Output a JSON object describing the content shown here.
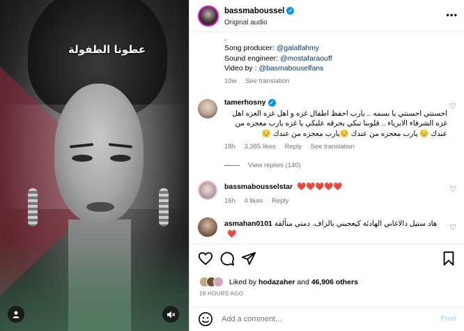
{
  "media": {
    "overlay_text": "عطونا الطفولة",
    "user_icon": "user-icon",
    "mute_icon": "speaker-muted-icon"
  },
  "post": {
    "username": "bassmaboussel",
    "audio": "Original audio",
    "more": "•••"
  },
  "caption": {
    "dot": ".",
    "lines": [
      {
        "label": "Song producer: ",
        "mention": "@galalfahmy"
      },
      {
        "label": "Sound engineer: ",
        "mention": "@mostafaraouff"
      },
      {
        "label": "Video by : ",
        "mention": "@basmabouselfans"
      }
    ],
    "time": "10w",
    "see_translation": "See translation"
  },
  "comments": [
    {
      "username": "tamerhosny",
      "verified": true,
      "text": "احسنتي احسنتي يا بسمه .. يارب احفظ اطفال غزه و اهل غزه العزه اهل غزه الشرفاء الابرياء .. قلوبنا تبكي بحرقه عليكي يا غزه يارب معجزه من عندك 😔 يارب معجزه من عندك 😔يارب معجزه من عندك 😔",
      "time": "18h",
      "likes": "3,385 likes",
      "reply": "Reply",
      "see_translation": "See translation",
      "view_replies": "View replies (140)"
    },
    {
      "username": "bassmabousselstar",
      "text": "❤️❤️❤️❤️❤️",
      "time": "16h",
      "likes": "4 likes",
      "reply": "Reply"
    },
    {
      "username": "asmahan0101",
      "text": "هاد ستيل دالاغاني الهادئة كيعجبني بالزاف. دمتي متألقة❤️"
    }
  ],
  "likes": {
    "prefix": "Liked by ",
    "user": "hodazaher",
    "middle": " and ",
    "others": "46,906 others"
  },
  "posted": "18 HOURS AGO",
  "add_comment": {
    "placeholder": "Add a comment...",
    "post_label": "Post"
  },
  "colors": {
    "link": "#00376b",
    "verified": "#0095f6",
    "muted": "#737373",
    "post_disabled": "#b2dffc"
  }
}
